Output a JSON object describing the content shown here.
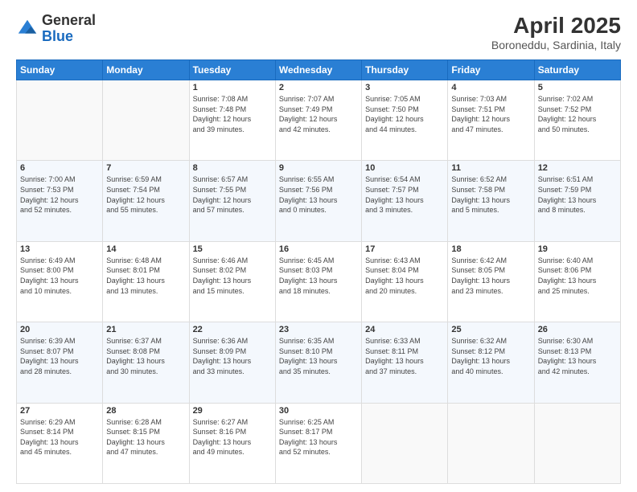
{
  "header": {
    "logo": {
      "general": "General",
      "blue": "Blue"
    },
    "title": "April 2025",
    "subtitle": "Boroneddu, Sardinia, Italy"
  },
  "calendar": {
    "weekdays": [
      "Sunday",
      "Monday",
      "Tuesday",
      "Wednesday",
      "Thursday",
      "Friday",
      "Saturday"
    ],
    "weeks": [
      [
        {
          "day": "",
          "info": ""
        },
        {
          "day": "",
          "info": ""
        },
        {
          "day": "1",
          "info": "Sunrise: 7:08 AM\nSunset: 7:48 PM\nDaylight: 12 hours\nand 39 minutes."
        },
        {
          "day": "2",
          "info": "Sunrise: 7:07 AM\nSunset: 7:49 PM\nDaylight: 12 hours\nand 42 minutes."
        },
        {
          "day": "3",
          "info": "Sunrise: 7:05 AM\nSunset: 7:50 PM\nDaylight: 12 hours\nand 44 minutes."
        },
        {
          "day": "4",
          "info": "Sunrise: 7:03 AM\nSunset: 7:51 PM\nDaylight: 12 hours\nand 47 minutes."
        },
        {
          "day": "5",
          "info": "Sunrise: 7:02 AM\nSunset: 7:52 PM\nDaylight: 12 hours\nand 50 minutes."
        }
      ],
      [
        {
          "day": "6",
          "info": "Sunrise: 7:00 AM\nSunset: 7:53 PM\nDaylight: 12 hours\nand 52 minutes."
        },
        {
          "day": "7",
          "info": "Sunrise: 6:59 AM\nSunset: 7:54 PM\nDaylight: 12 hours\nand 55 minutes."
        },
        {
          "day": "8",
          "info": "Sunrise: 6:57 AM\nSunset: 7:55 PM\nDaylight: 12 hours\nand 57 minutes."
        },
        {
          "day": "9",
          "info": "Sunrise: 6:55 AM\nSunset: 7:56 PM\nDaylight: 13 hours\nand 0 minutes."
        },
        {
          "day": "10",
          "info": "Sunrise: 6:54 AM\nSunset: 7:57 PM\nDaylight: 13 hours\nand 3 minutes."
        },
        {
          "day": "11",
          "info": "Sunrise: 6:52 AM\nSunset: 7:58 PM\nDaylight: 13 hours\nand 5 minutes."
        },
        {
          "day": "12",
          "info": "Sunrise: 6:51 AM\nSunset: 7:59 PM\nDaylight: 13 hours\nand 8 minutes."
        }
      ],
      [
        {
          "day": "13",
          "info": "Sunrise: 6:49 AM\nSunset: 8:00 PM\nDaylight: 13 hours\nand 10 minutes."
        },
        {
          "day": "14",
          "info": "Sunrise: 6:48 AM\nSunset: 8:01 PM\nDaylight: 13 hours\nand 13 minutes."
        },
        {
          "day": "15",
          "info": "Sunrise: 6:46 AM\nSunset: 8:02 PM\nDaylight: 13 hours\nand 15 minutes."
        },
        {
          "day": "16",
          "info": "Sunrise: 6:45 AM\nSunset: 8:03 PM\nDaylight: 13 hours\nand 18 minutes."
        },
        {
          "day": "17",
          "info": "Sunrise: 6:43 AM\nSunset: 8:04 PM\nDaylight: 13 hours\nand 20 minutes."
        },
        {
          "day": "18",
          "info": "Sunrise: 6:42 AM\nSunset: 8:05 PM\nDaylight: 13 hours\nand 23 minutes."
        },
        {
          "day": "19",
          "info": "Sunrise: 6:40 AM\nSunset: 8:06 PM\nDaylight: 13 hours\nand 25 minutes."
        }
      ],
      [
        {
          "day": "20",
          "info": "Sunrise: 6:39 AM\nSunset: 8:07 PM\nDaylight: 13 hours\nand 28 minutes."
        },
        {
          "day": "21",
          "info": "Sunrise: 6:37 AM\nSunset: 8:08 PM\nDaylight: 13 hours\nand 30 minutes."
        },
        {
          "day": "22",
          "info": "Sunrise: 6:36 AM\nSunset: 8:09 PM\nDaylight: 13 hours\nand 33 minutes."
        },
        {
          "day": "23",
          "info": "Sunrise: 6:35 AM\nSunset: 8:10 PM\nDaylight: 13 hours\nand 35 minutes."
        },
        {
          "day": "24",
          "info": "Sunrise: 6:33 AM\nSunset: 8:11 PM\nDaylight: 13 hours\nand 37 minutes."
        },
        {
          "day": "25",
          "info": "Sunrise: 6:32 AM\nSunset: 8:12 PM\nDaylight: 13 hours\nand 40 minutes."
        },
        {
          "day": "26",
          "info": "Sunrise: 6:30 AM\nSunset: 8:13 PM\nDaylight: 13 hours\nand 42 minutes."
        }
      ],
      [
        {
          "day": "27",
          "info": "Sunrise: 6:29 AM\nSunset: 8:14 PM\nDaylight: 13 hours\nand 45 minutes."
        },
        {
          "day": "28",
          "info": "Sunrise: 6:28 AM\nSunset: 8:15 PM\nDaylight: 13 hours\nand 47 minutes."
        },
        {
          "day": "29",
          "info": "Sunrise: 6:27 AM\nSunset: 8:16 PM\nDaylight: 13 hours\nand 49 minutes."
        },
        {
          "day": "30",
          "info": "Sunrise: 6:25 AM\nSunset: 8:17 PM\nDaylight: 13 hours\nand 52 minutes."
        },
        {
          "day": "",
          "info": ""
        },
        {
          "day": "",
          "info": ""
        },
        {
          "day": "",
          "info": ""
        }
      ]
    ]
  }
}
